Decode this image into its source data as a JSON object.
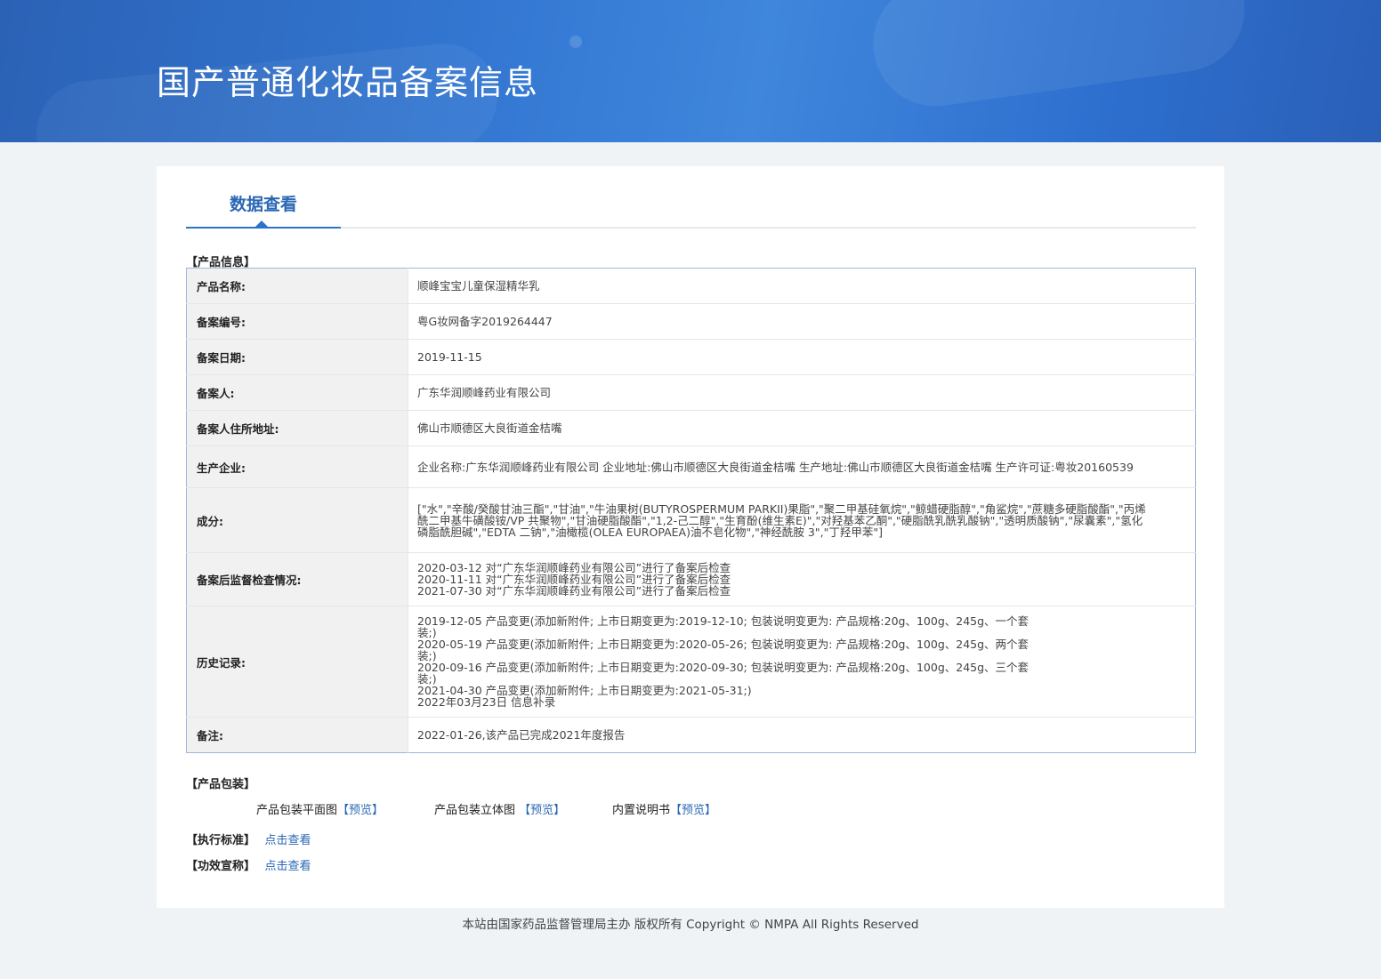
{
  "header": {
    "title": "国产普通化妆品备案信息"
  },
  "tabs": [
    {
      "label": "数据查看"
    }
  ],
  "product_info": {
    "section_title": "【产品信息】",
    "rows": [
      {
        "label": "产品名称:",
        "value": "顺峰宝宝儿童保湿精华乳"
      },
      {
        "label": "备案编号:",
        "value": "粤G妆网备字2019264447"
      },
      {
        "label": "备案日期:",
        "value": "2019-11-15"
      },
      {
        "label": "备案人:",
        "value": "广东华润顺峰药业有限公司"
      },
      {
        "label": "备案人住所地址:",
        "value": "佛山市顺德区大良街道金桔嘴"
      },
      {
        "label": "生产企业:",
        "value": "企业名称:广东华润顺峰药业有限公司 企业地址:佛山市顺德区大良街道金桔嘴 生产地址:佛山市顺德区大良街道金桔嘴 生产许可证:粤妆20160539"
      },
      {
        "label": "成分:",
        "value": "[\"水\",\"辛酸/癸酸甘油三酯\",\"甘油\",\"牛油果树(BUTYROSPERMUM PARKII)果脂\",\"聚二甲基硅氧烷\",\"鲸蜡硬脂醇\",\"角鲨烷\",\"蔗糖多硬脂酸酯\",\"丙烯酰二甲基牛磺酸铵/VP 共聚物\",\"甘油硬脂酸酯\",\"1,2-己二醇\",\"生育酚(维生素E)\",\"对羟基苯乙酮\",\"硬脂酰乳酰乳酸钠\",\"透明质酸钠\",\"尿囊素\",\"氢化磷脂酰胆碱\",\"EDTA 二钠\",\"油橄榄(OLEA EUROPAEA)油不皂化物\",\"神经酰胺 3\",\"丁羟甲苯\"]"
      },
      {
        "label": "备案后监督检查情况:",
        "lines": [
          "2020-03-12 对“广东华润顺峰药业有限公司”进行了备案后检查",
          "2020-11-11 对“广东华润顺峰药业有限公司”进行了备案后检查",
          "2021-07-30 对“广东华润顺峰药业有限公司”进行了备案后检查"
        ]
      },
      {
        "label": "历史记录:",
        "lines": [
          "2019-12-05 产品变更(添加新附件; 上市日期变更为:2019-12-10; 包装说明变更为: 产品规格:20g、100g、245g、一个套装;)",
          "2020-05-19 产品变更(添加新附件; 上市日期变更为:2020-05-26; 包装说明变更为: 产品规格:20g、100g、245g、两个套装;)",
          "2020-09-16 产品变更(添加新附件; 上市日期变更为:2020-09-30; 包装说明变更为: 产品规格:20g、100g、245g、三个套装;)",
          "2021-04-30 产品变更(添加新附件; 上市日期变更为:2021-05-31;)",
          "2022年03月23日 信息补录"
        ]
      },
      {
        "label": "备注:",
        "value": "2022-01-26,该产品已完成2021年度报告"
      }
    ]
  },
  "packaging": {
    "section_title": "【产品包装】",
    "items": [
      {
        "label": "产品包装平面图",
        "link": "【预览】"
      },
      {
        "label": "产品包装立体图",
        "link": "【预览】"
      },
      {
        "label": "内置说明书",
        "link": "【预览】"
      }
    ]
  },
  "standard": {
    "section_title": "【执行标准】",
    "link": "点击查看"
  },
  "efficacy": {
    "section_title": "【功效宣称】",
    "link": "点击查看"
  },
  "footer": {
    "text": "本站由国家药品监督管理局主办 版权所有 Copyright © NMPA All Rights Reserved"
  }
}
